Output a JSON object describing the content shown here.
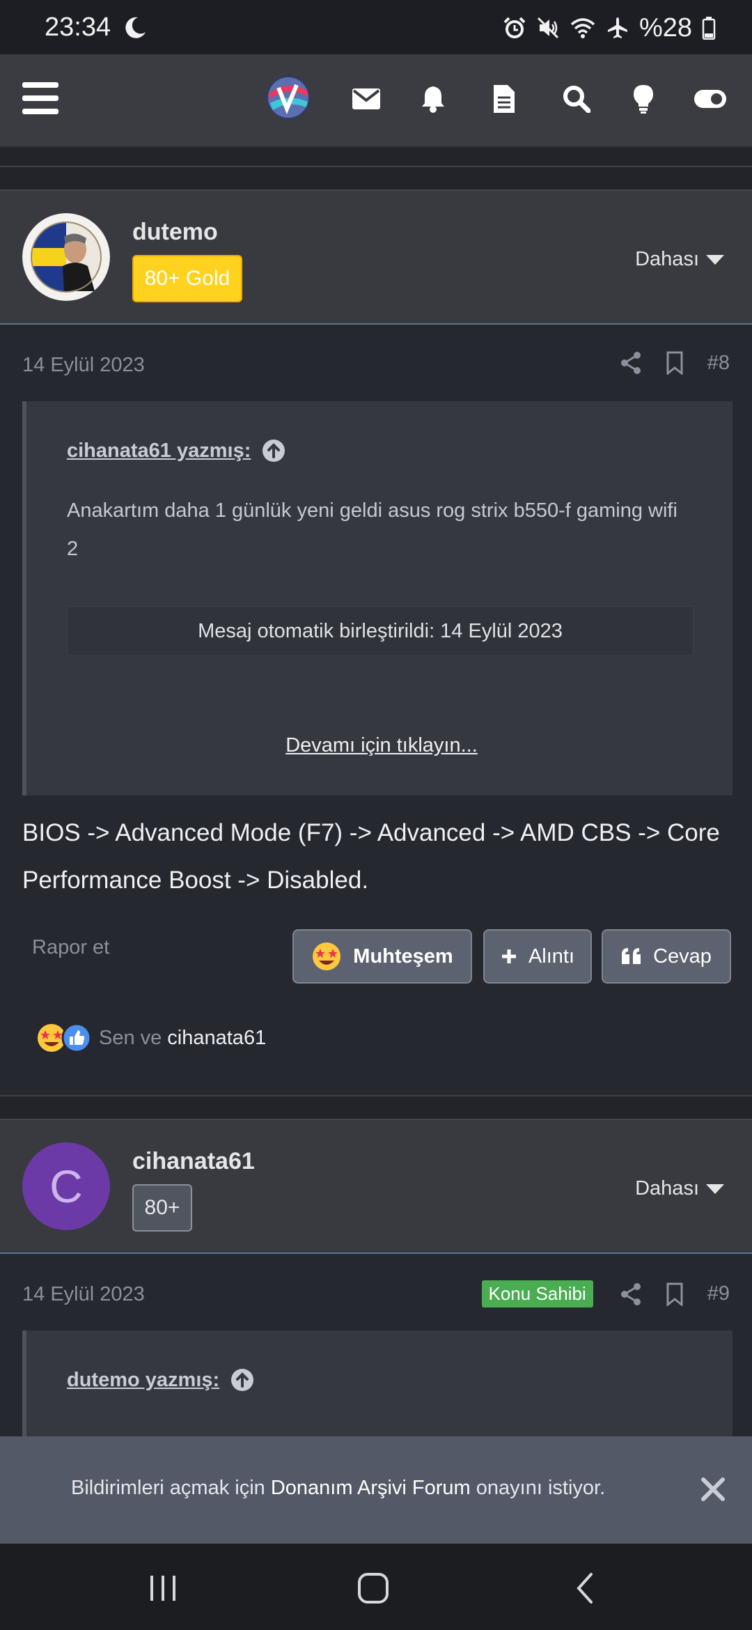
{
  "status_bar": {
    "time": "23:34",
    "battery": "%28"
  },
  "header": {
    "icons": [
      "menu-icon",
      "site-logo",
      "mail-icon",
      "bell-icon",
      "document-icon",
      "search-icon",
      "lightbulb-icon",
      "toggle-icon"
    ]
  },
  "posts": [
    {
      "user": {
        "name": "dutemo",
        "badge": "80+ Gold",
        "more": "Dahası"
      },
      "date": "14 Eylül 2023",
      "number": "#8",
      "quote": {
        "author": "cihanata61 yazmış:",
        "text": "Anakartım daha 1 günlük yeni geldi asus rog strix b550-f gaming wifi 2",
        "merge": "Mesaj otomatik birleştirildi: 14 Eylül 2023",
        "read_more": "Devamı için tıklayın..."
      },
      "body": "BIOS -> Advanced Mode (F7) -> Advanced -> AMD CBS -> Core Performance Boost -> Disabled.",
      "actions": {
        "report": "Rapor et",
        "react": "Muhteşem",
        "quote": "Alıntı",
        "reply": "Cevap"
      },
      "reactions": {
        "prefix": "Sen ve",
        "users": "cihanata61"
      }
    },
    {
      "user": {
        "name": "cihanata61",
        "avatar_letter": "C",
        "badge": "80+",
        "more": "Dahası"
      },
      "date": "14 Eylül 2023",
      "owner_badge": "Konu Sahibi",
      "number": "#9",
      "quote": {
        "author": "dutemo yazmış:"
      }
    }
  ],
  "notification": {
    "prefix": "Bildirimleri açmak için",
    "app": "Donanım Arşivi Forum",
    "suffix": "onayını istiyor."
  },
  "colors": {
    "gold_badge": "#ffd21f",
    "owner_badge": "#4aad52",
    "avatar_purple": "#6c3aa6",
    "divider_blue": "#5b7490"
  }
}
